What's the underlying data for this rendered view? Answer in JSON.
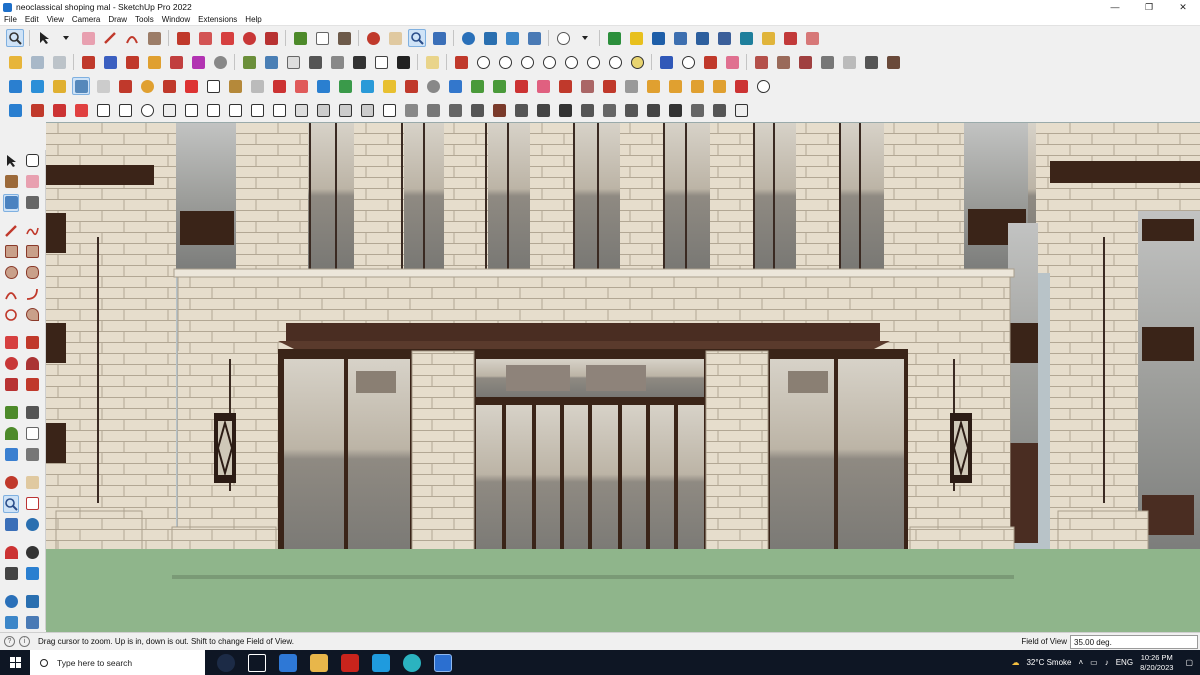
{
  "window": {
    "title": "neoclassical shoping mal - SketchUp Pro 2022",
    "minimize_glyph": "—",
    "restore_glyph": "❐",
    "close_glyph": "✕"
  },
  "menu": [
    "File",
    "Edit",
    "View",
    "Camera",
    "Draw",
    "Tools",
    "Window",
    "Extensions",
    "Help"
  ],
  "status": {
    "message": "Drag cursor to zoom.  Up is in, down is out. Shift to change Field of View.",
    "vcb_label": "Field of View",
    "vcb_value": "35.00 deg."
  },
  "taskbar": {
    "search_placeholder": "Type here to search",
    "weather": "32°C  Smoke",
    "language": "ENG",
    "time": "10:26 PM",
    "date": "8/20/2023"
  },
  "colors": {
    "stone": "#e5dccb",
    "bronze": "#4a2d22",
    "glass": "#8a8a88",
    "lawn": "#8fb58b",
    "taskbar": "#0e1624"
  }
}
